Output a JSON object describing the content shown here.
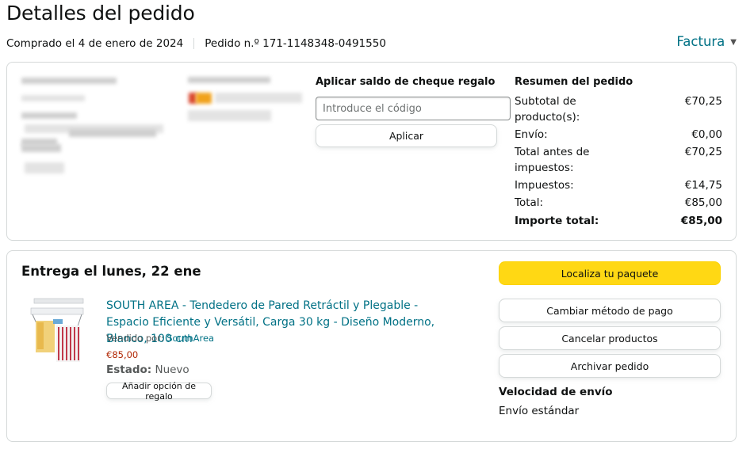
{
  "page": {
    "title": "Detalles del pedido",
    "purchase_date": "Comprado el 4 de enero de 2024",
    "order_number": "Pedido n.º 171-1148348-0491550",
    "invoice_label": "Factura"
  },
  "gift_card": {
    "title": "Aplicar saldo de cheque regalo",
    "placeholder": "Introduce el código",
    "apply_label": "Aplicar"
  },
  "summary": {
    "title": "Resumen del pedido",
    "rows": [
      {
        "label": "Subtotal de producto(s):",
        "value": "€70,25"
      },
      {
        "label": "Envío:",
        "value": "€0,00"
      },
      {
        "label": "Total antes de impuestos:",
        "value": "€70,25"
      },
      {
        "label": "Impuestos:",
        "value": "€14,75"
      },
      {
        "label": "Total:",
        "value": "€85,00"
      }
    ],
    "grand_total_label": "Importe total:",
    "grand_total_value": "€85,00"
  },
  "delivery": {
    "title": "Entrega el lunes, 22 ene",
    "product": {
      "name": "SOUTH AREA - Tendedero de Pared Retráctil y Plegable - Espacio Eficiente y Versátil, Carga 30 kg - Diseño Moderno, Blanco, 100 cm",
      "sold_by_label": "Vendido por:",
      "seller": "SouthArea",
      "price": "€85,00",
      "status_label": "Estado:",
      "status_value": "Nuevo",
      "gift_option_label": "Añadir opción de regalo"
    },
    "actions": {
      "track": "Localiza tu paquete",
      "change_payment": "Cambiar método de pago",
      "cancel": "Cancelar productos",
      "archive": "Archivar pedido"
    },
    "shipping_speed_title": "Velocidad de envío",
    "shipping_speed_value": "Envío estándar"
  },
  "colors": {
    "link": "#007185",
    "price": "#b12704",
    "primary_button": "#ffd814",
    "border": "#d5d9d9"
  },
  "icons": {
    "invoice_chevron": "chevron-down-icon"
  }
}
